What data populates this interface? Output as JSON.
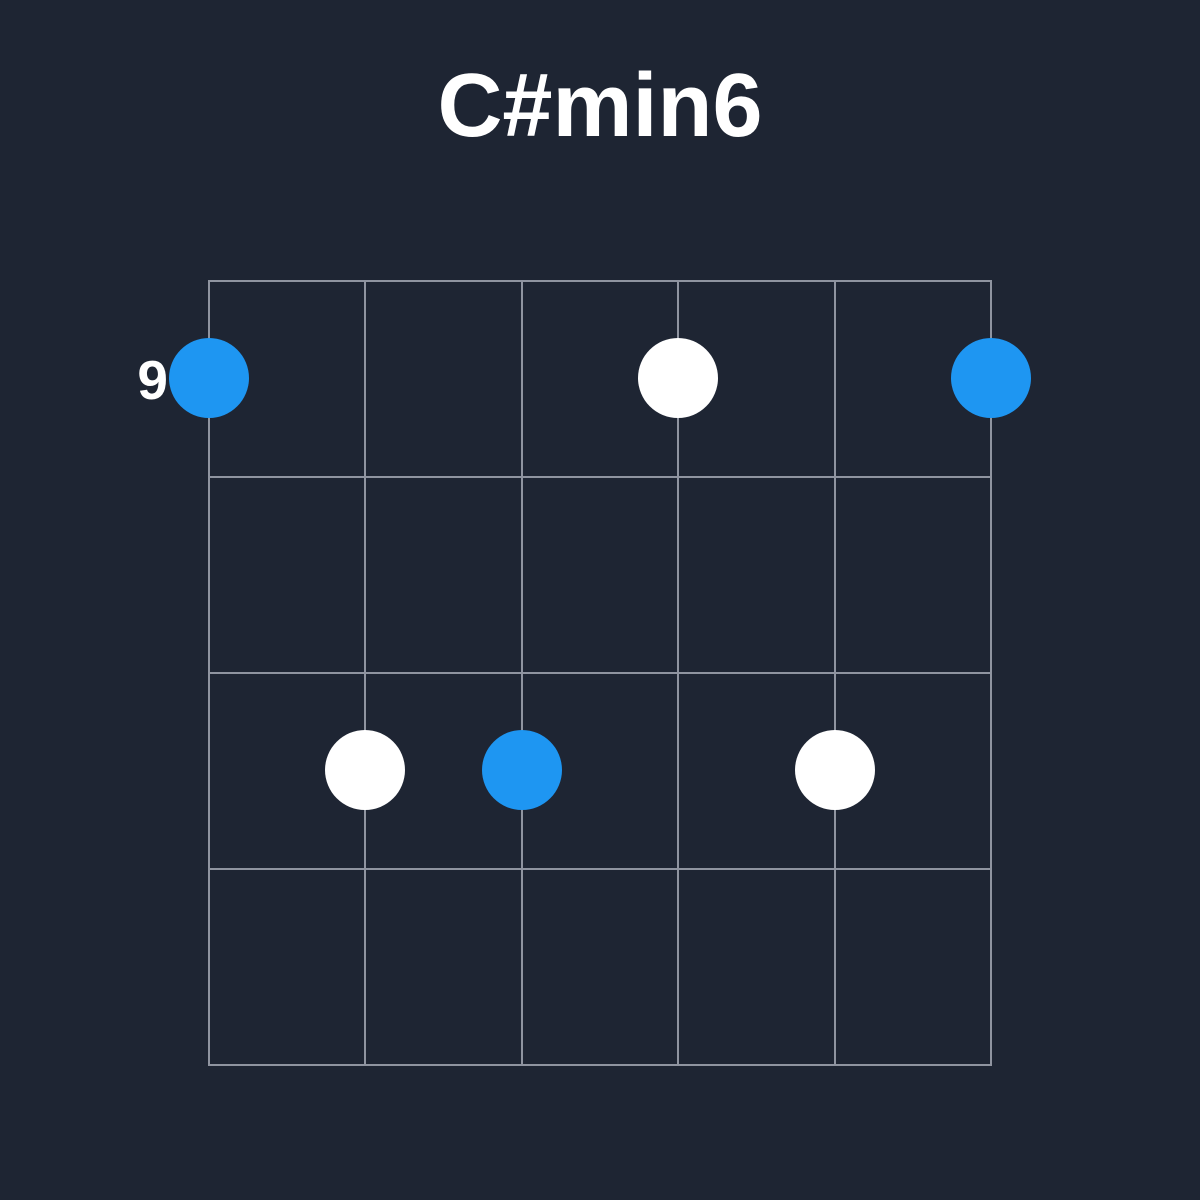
{
  "chord_name": "C#min6",
  "fret_label": "9",
  "colors": {
    "background": "#1e2533",
    "grid": "#8f94a0",
    "text": "#ffffff",
    "accent": "#1e96f2",
    "dot_white": "#ffffff"
  },
  "chart_data": {
    "type": "chord-diagram",
    "strings": 6,
    "frets_shown": 5,
    "starting_fret": 9,
    "dots": [
      {
        "string": 1,
        "fret_row": 1,
        "color": "accent"
      },
      {
        "string": 4,
        "fret_row": 1,
        "color": "white"
      },
      {
        "string": 6,
        "fret_row": 1,
        "color": "accent"
      },
      {
        "string": 2,
        "fret_row": 3,
        "color": "white"
      },
      {
        "string": 3,
        "fret_row": 3,
        "color": "accent"
      },
      {
        "string": 5,
        "fret_row": 3,
        "color": "white"
      }
    ]
  }
}
